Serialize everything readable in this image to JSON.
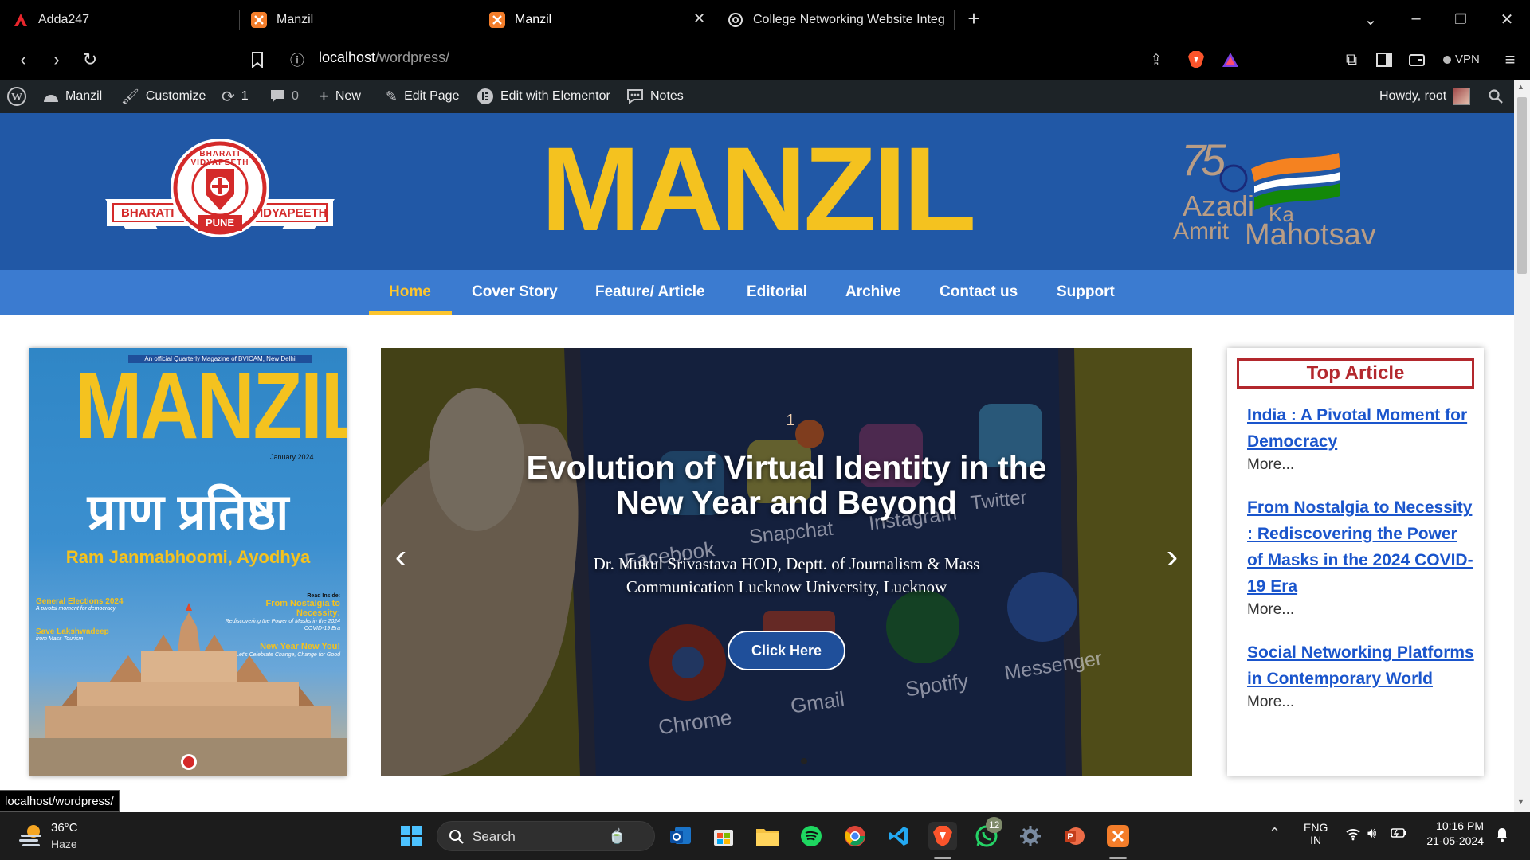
{
  "browser": {
    "tabs": [
      {
        "title": "Adda247"
      },
      {
        "title": "Manzil"
      },
      {
        "title": "Manzil"
      },
      {
        "title": "College Networking Website Integrat"
      }
    ],
    "url_host": "localhost",
    "url_path": "/wordpress/",
    "vpn_label": "VPN"
  },
  "wp_admin": {
    "site_name": "Manzil",
    "customize": "Customize",
    "updates_count": "1",
    "comments_count": "0",
    "new_label": "New",
    "edit_page": "Edit Page",
    "elementor": "Edit with Elementor",
    "notes": "Notes",
    "howdy": "Howdy, root"
  },
  "header": {
    "logo_left_top": "BHARATI VIDYAPEETH",
    "logo_left_city": "PUNE",
    "logo_left_wings": [
      "BHARATI",
      "VIDYAPEETH"
    ],
    "title": "MANZIL",
    "azadi_number": "75",
    "azadi_line1": "Azadi",
    "azadi_ka": "Ka",
    "azadi_line2a": "Amrit",
    "azadi_line2b": "Mahotsav"
  },
  "nav": {
    "items": [
      "Home",
      "Cover Story",
      "Feature/ Article",
      "Editorial",
      "Archive",
      "Contact us",
      "Support"
    ],
    "active": "Home"
  },
  "cover": {
    "tagline": "An official Quarterly Magazine of BVICAM, New Delhi",
    "title": "MANZIL",
    "date": "January 2024",
    "hindi_title": "प्राण प्रतिष्ठा",
    "subtitle": "Ram Janmabhoomi, Ayodhya",
    "left_blurbs": [
      {
        "head": "General Elections 2024",
        "sub": "A pivotal moment for democracy"
      },
      {
        "head": "Save Lakshwadeep",
        "sub": "from Mass Tourism"
      }
    ],
    "read_inside": "Read Inside:",
    "right_blurbs": [
      {
        "head": "From Nostalgia to Necessity:",
        "sub": "Rediscovering the Power of Masks in the 2024 COVID-19 Era"
      },
      {
        "head": "New Year New You!",
        "sub": "Let's Celebrate Change, Change for Good"
      }
    ]
  },
  "slider": {
    "title": "Evolution of Virtual Identity in the New Year and Beyond",
    "author": "Dr. Mukul Srivastava HOD, Deptt. of Journalism & Mass Communication Lucknow University, Lucknow",
    "button": "Click Here",
    "prev": "‹",
    "next": "›",
    "app_labels": [
      "Facebook",
      "Snapchat",
      "Instagram",
      "Twitter",
      "Chrome",
      "Gmail",
      "Spotify",
      "Messenger"
    ],
    "badge": "1"
  },
  "top_articles": {
    "heading": "Top Article",
    "items": [
      {
        "title": "India : A Pivotal Moment for Democracy",
        "more": "More..."
      },
      {
        "title": "From Nostalgia to Necessity : Rediscovering the Power of Masks in the 2024 COVID-19 Era",
        "more": "More..."
      },
      {
        "title": "Social Networking Platforms in Contemporary World",
        "more": "More..."
      }
    ]
  },
  "status_link": "localhost/wordpress/",
  "taskbar": {
    "weather_temp": "36°C",
    "weather_desc": "Haze",
    "search": "Search",
    "whatsapp_badge": "12",
    "lang1": "ENG",
    "lang2": "IN",
    "time": "10:16 PM",
    "date": "21-05-2024"
  },
  "colors": {
    "header_blue": "#2158a6",
    "nav_blue": "#3b7bd0",
    "manzil_yellow": "#f4c21f",
    "active_nav": "#fcc52e",
    "link_blue": "#1a55cc",
    "top_article_red": "#b3282d"
  }
}
